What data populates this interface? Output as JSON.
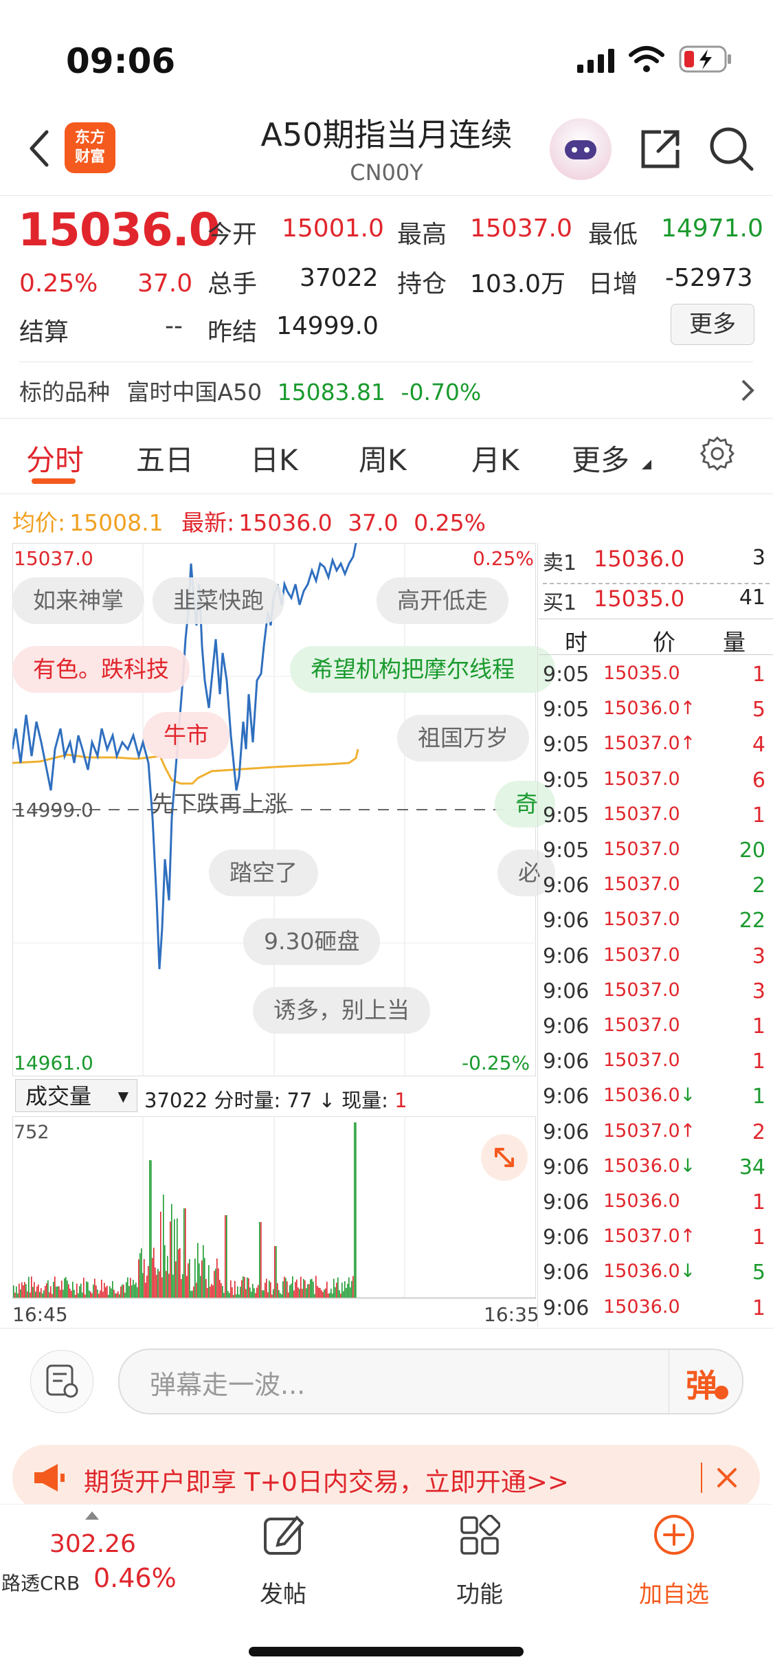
{
  "status_bar": {
    "time": "09:06"
  },
  "header": {
    "brand_logo_line1": "东方",
    "brand_logo_line2": "财富",
    "title": "A50期指当月连续",
    "subtitle": "CN00Y"
  },
  "quote": {
    "price": "15036.0",
    "change_pct": "0.25%",
    "change_abs": "37.0",
    "open_label": "今开",
    "open": "15001.0",
    "high_label": "最高",
    "high": "15037.0",
    "low_label": "最低",
    "low": "14971.0",
    "volume_label": "总手",
    "volume": "37022",
    "oi_label": "持仓",
    "oi": "103.0万",
    "daily_inc_label": "日增",
    "daily_inc": "-52973",
    "settle_label": "结算",
    "settle": "--",
    "prev_settle_label": "昨结",
    "prev_settle": "14999.0",
    "more_button": "更多"
  },
  "underlying": {
    "label": "标的品种",
    "name": "富时中国A50",
    "price": "15083.81",
    "change": "-0.70%"
  },
  "tabs": [
    "分时",
    "五日",
    "日K",
    "周K",
    "月K",
    "更多"
  ],
  "chart_info": {
    "avg_label": "均价:",
    "avg_value": "15008.1",
    "latest_label": "最新:",
    "latest_value": "15036.0",
    "latest_change": "37.0",
    "latest_pct": "0.25%",
    "y_top": "15037.0",
    "y_mid": "14999.0",
    "y_bottom": "14961.0",
    "pct_top": "0.25%",
    "pct_bottom": "-0.25%",
    "volume_selector": "成交量",
    "volume_total": "37022",
    "minute_vol_label": "分时量:",
    "minute_vol": "77",
    "current_vol_label": "现量:",
    "current_vol": "1",
    "vol_max": "752",
    "time_start": "16:45",
    "time_end": "16:35"
  },
  "danmu": [
    "如来神掌",
    "韭菜快跑",
    "高开低走",
    "有色。跌科技",
    "希望机构把摩尔线程",
    "祖国万岁",
    "牛市",
    "先下跌再上涨",
    "奇",
    "踏空了",
    "必",
    "9.30砸盘",
    "诱多，别上当"
  ],
  "order_book": {
    "sell_label": "卖1",
    "sell_price": "15036.0",
    "sell_vol": "3",
    "buy_label": "买1",
    "buy_price": "15035.0",
    "buy_vol": "41",
    "col_time": "时",
    "col_price": "价",
    "col_vol": "量",
    "ticks": [
      {
        "time": "9:05",
        "price": "15035.0",
        "arrow": "",
        "vol": "1",
        "vol_color": "red"
      },
      {
        "time": "9:05",
        "price": "15036.0",
        "arrow": "↑",
        "vol": "5",
        "vol_color": "red"
      },
      {
        "time": "9:05",
        "price": "15037.0",
        "arrow": "↑",
        "vol": "4",
        "vol_color": "red"
      },
      {
        "time": "9:05",
        "price": "15037.0",
        "arrow": "",
        "vol": "6",
        "vol_color": "red"
      },
      {
        "time": "9:05",
        "price": "15037.0",
        "arrow": "",
        "vol": "1",
        "vol_color": "red"
      },
      {
        "time": "9:05",
        "price": "15037.0",
        "arrow": "",
        "vol": "20",
        "vol_color": "green"
      },
      {
        "time": "9:06",
        "price": "15037.0",
        "arrow": "",
        "vol": "2",
        "vol_color": "green"
      },
      {
        "time": "9:06",
        "price": "15037.0",
        "arrow": "",
        "vol": "22",
        "vol_color": "green"
      },
      {
        "time": "9:06",
        "price": "15037.0",
        "arrow": "",
        "vol": "3",
        "vol_color": "red"
      },
      {
        "time": "9:06",
        "price": "15037.0",
        "arrow": "",
        "vol": "3",
        "vol_color": "red"
      },
      {
        "time": "9:06",
        "price": "15037.0",
        "arrow": "",
        "vol": "1",
        "vol_color": "red"
      },
      {
        "time": "9:06",
        "price": "15037.0",
        "arrow": "",
        "vol": "1",
        "vol_color": "red"
      },
      {
        "time": "9:06",
        "price": "15036.0",
        "arrow": "↓",
        "vol": "1",
        "vol_color": "green"
      },
      {
        "time": "9:06",
        "price": "15037.0",
        "arrow": "↑",
        "vol": "2",
        "vol_color": "red"
      },
      {
        "time": "9:06",
        "price": "15036.0",
        "arrow": "↓",
        "vol": "34",
        "vol_color": "green"
      },
      {
        "time": "9:06",
        "price": "15036.0",
        "arrow": "",
        "vol": "1",
        "vol_color": "red"
      },
      {
        "time": "9:06",
        "price": "15037.0",
        "arrow": "↑",
        "vol": "1",
        "vol_color": "red"
      },
      {
        "time": "9:06",
        "price": "15036.0",
        "arrow": "↓",
        "vol": "5",
        "vol_color": "green"
      },
      {
        "time": "9:06",
        "price": "15036.0",
        "arrow": "",
        "vol": "1",
        "vol_color": "red"
      }
    ]
  },
  "comment_input": {
    "placeholder": "弹幕走一波...",
    "danmu_button": "弹"
  },
  "promo": {
    "text": "期货开户即享 T+0日内交易，立即开通>>"
  },
  "bottom_bar": {
    "index_value": "302.26",
    "index_name": "路透CRB",
    "index_pct": "0.46%",
    "post_label": "发帖",
    "function_label": "功能",
    "add_label": "加自选"
  },
  "colors": {
    "up": "#e0262c",
    "down": "#1a9a2e",
    "accent": "#f45a1e",
    "price_line": "#2f6fbf",
    "avg_line": "#f0b030"
  }
}
